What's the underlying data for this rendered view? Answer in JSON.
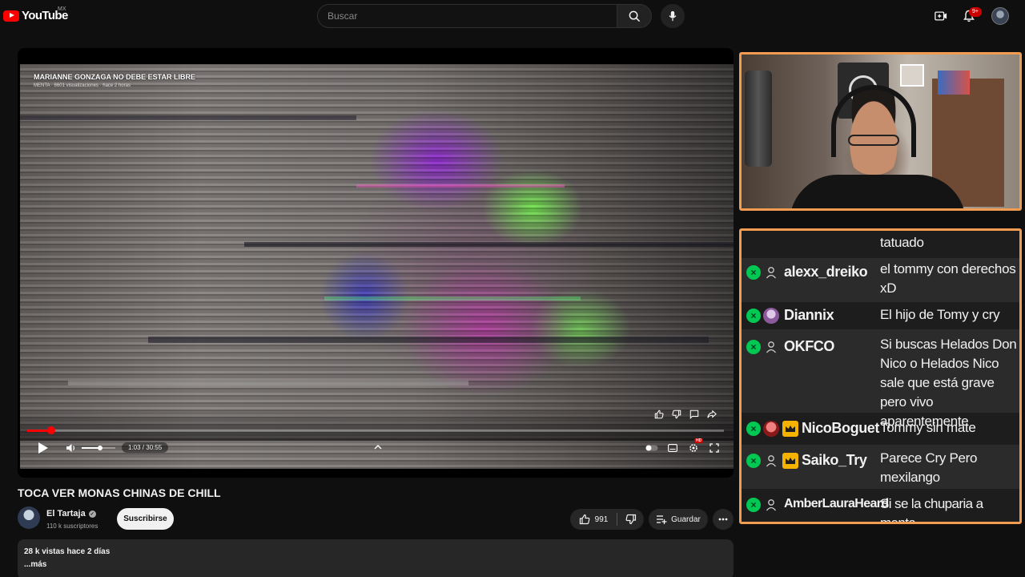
{
  "header": {
    "logo_text": "YouTube",
    "country": "MX",
    "search_placeholder": "Buscar",
    "notifications_badge": "9+"
  },
  "player": {
    "overlay_title": "MARIANNE GONZAGA NO DEBE ESTAR LIBRE",
    "overlay_meta": "MENTA  ·  8601 visualizaciones  ·  hace 2 horas",
    "time": "1:03 / 30:55",
    "progress_fraction": 0.034,
    "volume_fraction": 0.55
  },
  "video": {
    "title": "TOCA VER MONAS CHINAS DE CHILL",
    "channel": "El Tartaja",
    "subscribers": "110 k suscriptores",
    "subscribe_label": "Suscribirse",
    "likes": "991",
    "save_label": "Guardar",
    "views_date": "28 k vistas  hace 2 días",
    "more_label": "...más"
  },
  "chat": {
    "messages": [
      {
        "user": "",
        "text": "tatuado"
      },
      {
        "user": "alexx_dreiko",
        "text": "el tommy con derechos xD"
      },
      {
        "user": "Diannix",
        "text": "El hijo de Tomy y cry"
      },
      {
        "user": "OKFCO",
        "text": "Si buscas Helados Don Nico o Helados Nico sale que está grave pero vivo aparentemente"
      },
      {
        "user": "NicoBoguet",
        "text": "Tommy sin mate"
      },
      {
        "user": "Saiko_Try",
        "text": "Parece Cry Pero mexilango"
      },
      {
        "user": "AmberLauraHeard",
        "text": "Si se la chuparia a menta"
      }
    ]
  },
  "colors": {
    "accent": "#ff0000",
    "panel_border": "#f29c52",
    "mod_badge": "#00c853",
    "crown": "#f5b300"
  },
  "icons": [
    "search-icon",
    "mic-icon",
    "create-icon",
    "bell-icon",
    "play-icon",
    "volume-icon",
    "like-icon",
    "dislike-icon",
    "playlist-add-icon",
    "more-icon",
    "settings-icon",
    "fullscreen-icon"
  ]
}
